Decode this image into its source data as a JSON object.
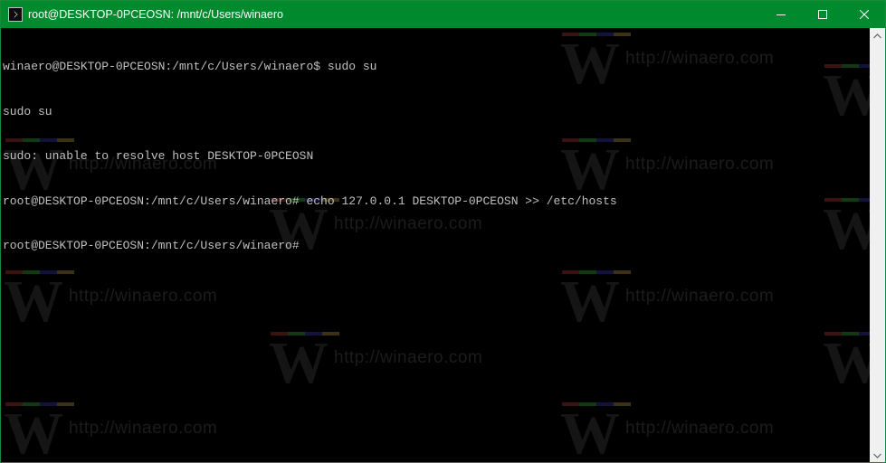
{
  "window": {
    "title": "root@DESKTOP-0PCEOSN: /mnt/c/Users/winaero",
    "icon": "console-icon",
    "controls": [
      "minimize-icon",
      "maximize-icon",
      "close-icon"
    ],
    "titlebar_color": "#008a2e"
  },
  "console": {
    "background": "#000000",
    "foreground": "#c0c0c0",
    "lines": [
      "winaero@DESKTOP-0PCEOSN:/mnt/c/Users/winaero$ sudo su",
      "sudo su",
      "sudo: unable to resolve host DESKTOP-0PCEOSN",
      "root@DESKTOP-0PCEOSN:/mnt/c/Users/winaero# echo 127.0.0.1 DESKTOP-0PCEOSN >> /etc/hosts",
      "root@DESKTOP-0PCEOSN:/mnt/c/Users/winaero#"
    ]
  },
  "watermark": {
    "letter": "W",
    "url": "http://winaero.com"
  },
  "scrollbar": {
    "up_icon": "scroll-up-arrow-icon",
    "down_icon": "scroll-down-arrow-icon"
  }
}
